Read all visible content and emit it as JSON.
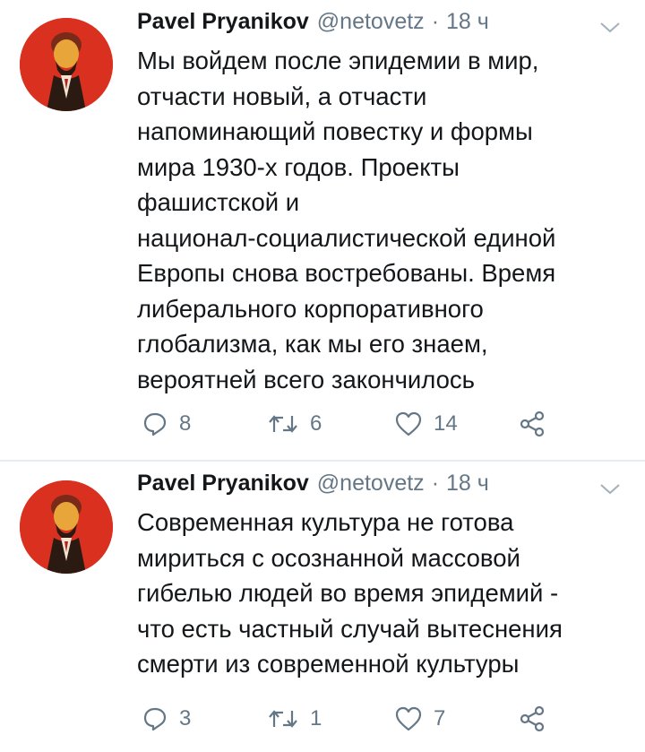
{
  "tweets": [
    {
      "author_name": "Pavel Pryanikov",
      "handle": "@netovetz",
      "separator": "·",
      "time": "18 ч",
      "text_lines": [
        "Мы войдем после эпидемии в мир,",
        "отчасти новый, а отчасти",
        "напоминающий повестку и формы",
        "мира 1930-х годов. Проекты",
        "фашистской и",
        "национал-социалистической единой",
        "Европы снова востребованы. Время",
        "либерального корпоративного",
        "глобализма, как мы его знаем,",
        "вероятней всего закончилось"
      ],
      "replies": "8",
      "retweets": "6",
      "likes": "14"
    },
    {
      "author_name": "Pavel Pryanikov",
      "handle": "@netovetz",
      "separator": "·",
      "time": "18 ч",
      "text_lines": [
        "Современная культура не готова",
        "мириться с осознанной массовой",
        "гибелью людей во время эпидемий -",
        "что есть частный случай вытеснения",
        "смерти из современной культуры"
      ],
      "replies": "3",
      "retweets": "1",
      "likes": "7"
    }
  ],
  "icons": {
    "reply": "reply-icon",
    "retweet": "retweet-icon",
    "like": "heart-icon",
    "share": "share-icon",
    "menu": "chevron-down-icon"
  },
  "colors": {
    "text": "#14171a",
    "secondary": "#657786",
    "avatar_bg": "#d9301f",
    "divider": "#e6ecf0"
  }
}
